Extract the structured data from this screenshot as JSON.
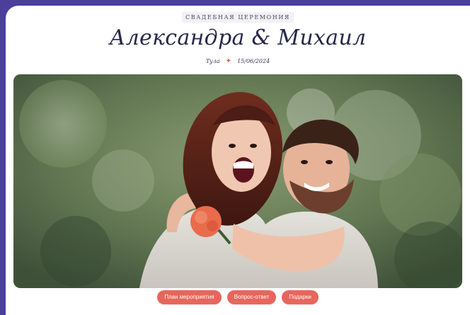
{
  "header": {
    "eyebrow": "СВАДЕБНАЯ ЦЕРЕМОНИЯ",
    "title": "Александра & Михаил",
    "location": "Тула",
    "date": "15/06/2024"
  },
  "actions": {
    "plan": "План мероприятия",
    "faq": "Вопрос-ответ",
    "gifts": "Подарки"
  },
  "theme": {
    "background": "#4b3f9c",
    "accent": "#e7665c",
    "heading": "#27264a"
  },
  "icons": {
    "separator": "sparkle-icon"
  }
}
